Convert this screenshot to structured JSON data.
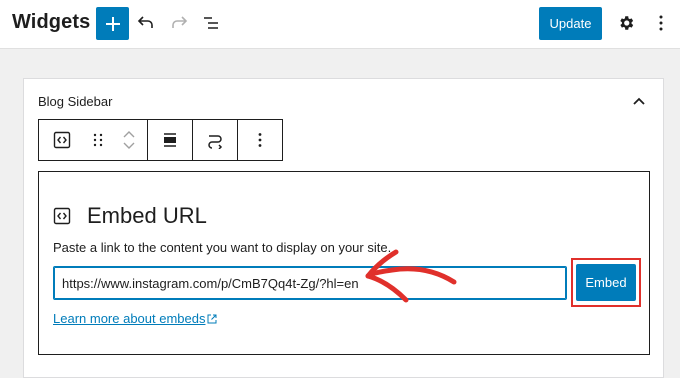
{
  "header": {
    "title": "Widgets",
    "update_label": "Update"
  },
  "panel": {
    "title": "Blog Sidebar"
  },
  "embed": {
    "title": "Embed URL",
    "instructions": "Paste a link to the content you want to display on your site.",
    "url_value": "https://www.instagram.com/p/CmB7Qq4t-Zg/?hl=en",
    "button_label": "Embed",
    "learn_more_label": "Learn more about embeds"
  },
  "colors": {
    "accent": "#007cba",
    "annotation": "#e0302b"
  },
  "icons": {
    "add": "plus-icon",
    "undo": "undo-icon",
    "redo": "redo-icon",
    "list_view": "list-view-icon",
    "settings": "gear-icon",
    "options": "more-vertical-icon",
    "collapse": "chevron-up-icon",
    "block": "embed-block-icon",
    "drag": "drag-handle-icon",
    "move_up": "chevron-up-icon",
    "move_down": "chevron-down-icon",
    "align": "align-icon",
    "transform": "transform-icon",
    "block_options": "more-vertical-icon",
    "external": "external-link-icon"
  }
}
